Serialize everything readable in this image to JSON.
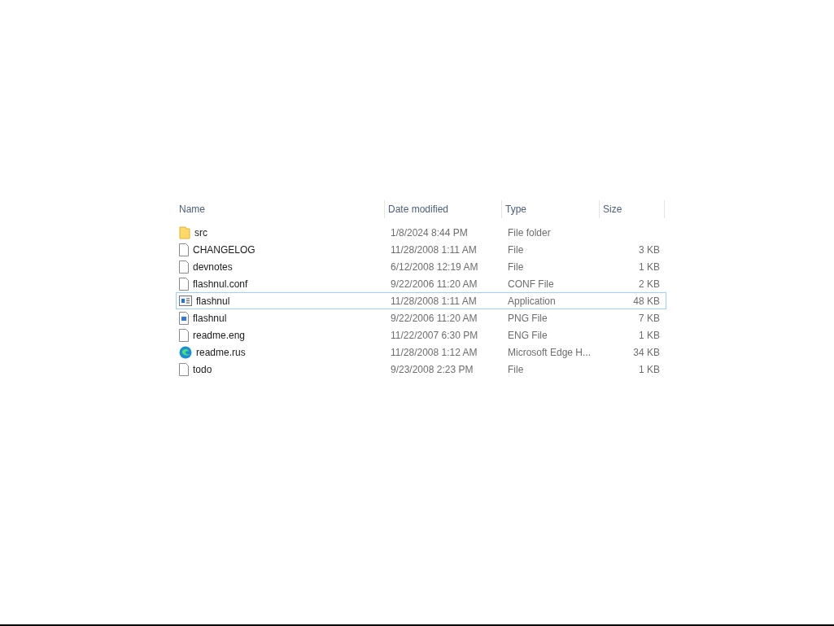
{
  "file_list": {
    "columns": [
      "Name",
      "Date modified",
      "Type",
      "Size"
    ],
    "rows": [
      {
        "kind": "folder",
        "name": "src",
        "date": "1/8/2024 8:44 PM",
        "type": "File folder",
        "size": "",
        "selected": false
      },
      {
        "kind": "file",
        "name": "CHANGELOG",
        "date": "11/28/2008 1:11 AM",
        "type": "File",
        "size": "3 KB",
        "selected": false
      },
      {
        "kind": "file",
        "name": "devnotes",
        "date": "6/12/2008 12:19 AM",
        "type": "File",
        "size": "1 KB",
        "selected": false
      },
      {
        "kind": "file",
        "name": "flashnul.conf",
        "date": "9/22/2006 11:20 AM",
        "type": "CONF File",
        "size": "2 KB",
        "selected": false
      },
      {
        "kind": "application",
        "name": "flashnul",
        "date": "11/28/2008 1:11 AM",
        "type": "Application",
        "size": "48 KB",
        "selected": true
      },
      {
        "kind": "image",
        "name": "flashnul",
        "date": "9/22/2006 11:20 AM",
        "type": "PNG File",
        "size": "7 KB",
        "selected": false
      },
      {
        "kind": "file",
        "name": "readme.eng",
        "date": "11/22/2007 6:30 PM",
        "type": "ENG File",
        "size": "1 KB",
        "selected": false
      },
      {
        "kind": "web",
        "name": "readme.rus",
        "date": "11/28/2008 1:12 AM",
        "type": "Microsoft Edge H...",
        "size": "34 KB",
        "selected": false
      },
      {
        "kind": "file",
        "name": "todo",
        "date": "9/23/2008 2:23 PM",
        "type": "File",
        "size": "1 KB",
        "selected": false
      }
    ]
  }
}
